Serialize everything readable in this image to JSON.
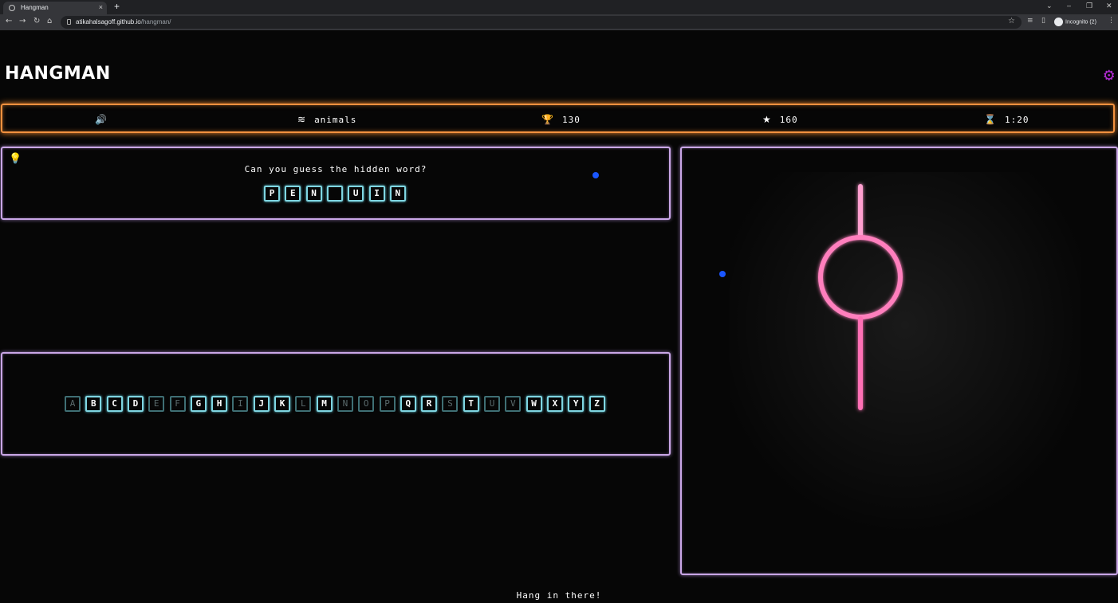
{
  "browser": {
    "tab_title": "Hangman",
    "tab_close": "×",
    "new_tab": "+",
    "url_host": "atikahalsagoff.github.io",
    "url_path": "/hangman/",
    "profile": "Incognito (2)",
    "win_minimize": "–",
    "win_restore": "❐",
    "win_close": "✕"
  },
  "header": {
    "logo": "HANGMAN",
    "settings_icon": "gear-icon"
  },
  "status": {
    "sound_icon": "🔊",
    "category_icon": "≋",
    "category": "animals",
    "trophy_icon": "🏆",
    "high_score": "130",
    "star_icon": "★",
    "score": "160",
    "timer_icon": "⌛",
    "timer": "1:20"
  },
  "puzzle": {
    "hint_icon": "💡",
    "prompt": "Can you guess the hidden word?",
    "letters": [
      "P",
      "E",
      "N",
      "",
      "U",
      "I",
      "N"
    ]
  },
  "keyboard": {
    "keys": [
      "A",
      "B",
      "C",
      "D",
      "E",
      "F",
      "G",
      "H",
      "I",
      "J",
      "K",
      "L",
      "M",
      "N",
      "O",
      "P",
      "Q",
      "R",
      "S",
      "T",
      "U",
      "V",
      "W",
      "X",
      "Y",
      "Z"
    ],
    "used": [
      "A",
      "E",
      "F",
      "I",
      "L",
      "N",
      "O",
      "P",
      "S",
      "U",
      "V"
    ]
  },
  "colors": {
    "status_border": "#f2913f",
    "panel_border": "#c9a6e6",
    "key_border": "#7fd6e2",
    "gear": "#b02bd0",
    "hangman_pink": "#ff6fb5"
  },
  "footer": {
    "message": "Hang in there!"
  }
}
